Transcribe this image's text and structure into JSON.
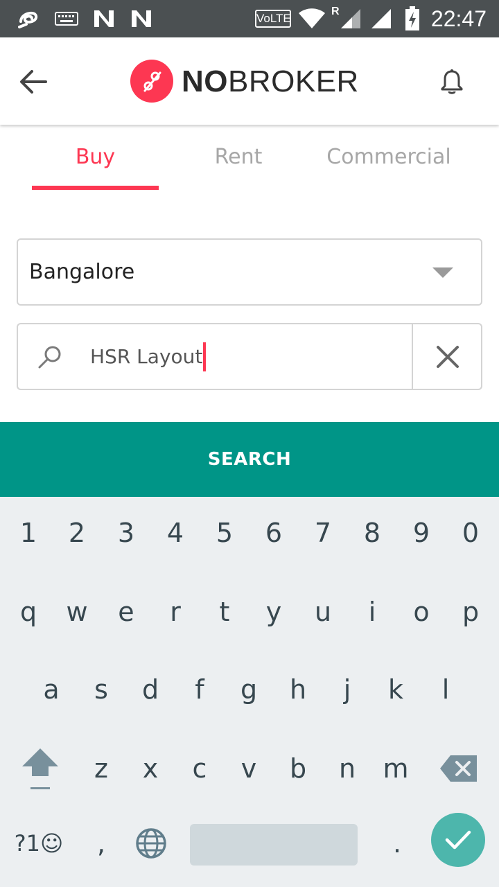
{
  "status_bar": {
    "time": "22:47",
    "volte": "VoLTE",
    "roaming": "R"
  },
  "app_bar": {
    "logo_bold": "NO",
    "logo_rest": "BROKER"
  },
  "tabs": [
    {
      "label": "Buy",
      "active": true
    },
    {
      "label": "Rent",
      "active": false
    },
    {
      "label": "Commercial",
      "active": false
    }
  ],
  "city_select": {
    "value": "Bangalore"
  },
  "search": {
    "value": "HSR Layout"
  },
  "search_button": {
    "label": "SEARCH"
  },
  "keyboard": {
    "row_numbers": [
      "1",
      "2",
      "3",
      "4",
      "5",
      "6",
      "7",
      "8",
      "9",
      "0"
    ],
    "row_1": [
      "q",
      "w",
      "e",
      "r",
      "t",
      "y",
      "u",
      "i",
      "o",
      "p"
    ],
    "row_2": [
      "a",
      "s",
      "d",
      "f",
      "g",
      "h",
      "j",
      "k",
      "l"
    ],
    "row_3": [
      "z",
      "x",
      "c",
      "v",
      "b",
      "n",
      "m"
    ],
    "symbols_label": "?1☺",
    "comma": ",",
    "period": "."
  },
  "colors": {
    "brand": "#fd3752",
    "accent_teal": "#009587",
    "status_bar": "#4b5052",
    "keyboard_bg": "#eceff1",
    "enter_key": "#4db6ac"
  }
}
